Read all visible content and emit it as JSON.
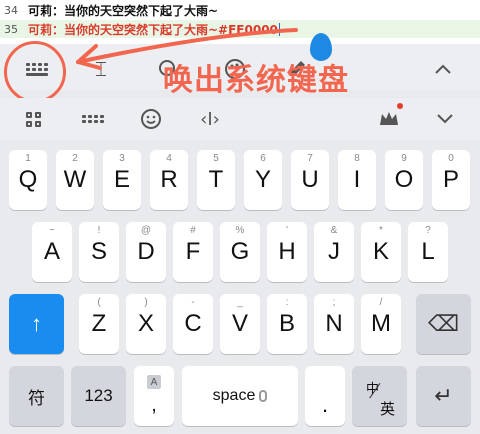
{
  "editor": {
    "lines": [
      {
        "number": "34",
        "text": "可莉：当你的天空突然下起了大雨~"
      },
      {
        "number": "35",
        "text": "可莉：当你的天空突然下起了大雨~#FF0000"
      }
    ]
  },
  "annotation": "唤出系统键盘",
  "colors": {
    "annotation": "#f2664f",
    "shift_key": "#1a8cf0",
    "line2_text": "#d93a2b"
  },
  "toolbar1": {
    "icons": [
      "keyboard-switch-icon",
      "text-cursor-icon",
      "search-icon",
      "palette-icon",
      "edit-icon",
      "chevron-up-icon"
    ],
    "chevron": "^"
  },
  "toolbar2": {
    "icons": [
      "grid-icon",
      "keyboard-icon",
      "emoji-icon",
      "cursor-move-icon",
      "crown-icon",
      "chevron-down-icon"
    ]
  },
  "keyboard": {
    "row1": [
      {
        "main": "Q",
        "sub": "1"
      },
      {
        "main": "W",
        "sub": "2"
      },
      {
        "main": "E",
        "sub": "3"
      },
      {
        "main": "R",
        "sub": "4"
      },
      {
        "main": "T",
        "sub": "5"
      },
      {
        "main": "Y",
        "sub": "6"
      },
      {
        "main": "U",
        "sub": "7"
      },
      {
        "main": "I",
        "sub": "8"
      },
      {
        "main": "O",
        "sub": "9"
      },
      {
        "main": "P",
        "sub": "0"
      }
    ],
    "row2": [
      {
        "main": "A",
        "sub": "~"
      },
      {
        "main": "S",
        "sub": "!"
      },
      {
        "main": "D",
        "sub": "@"
      },
      {
        "main": "F",
        "sub": "#"
      },
      {
        "main": "G",
        "sub": "%"
      },
      {
        "main": "H",
        "sub": "'"
      },
      {
        "main": "J",
        "sub": "&"
      },
      {
        "main": "K",
        "sub": "*"
      },
      {
        "main": "L",
        "sub": "?"
      }
    ],
    "row3": [
      {
        "main": "Z",
        "sub": "("
      },
      {
        "main": "X",
        "sub": ")"
      },
      {
        "main": "C",
        "sub": "-"
      },
      {
        "main": "V",
        "sub": "_"
      },
      {
        "main": "B",
        "sub": ":"
      },
      {
        "main": "N",
        "sub": ";"
      },
      {
        "main": "M",
        "sub": "/"
      }
    ],
    "shift": "↑",
    "backspace": "⌫",
    "symbols": "符",
    "numbers": "123",
    "comma": ",",
    "comma_badge": "A",
    "space": "space",
    "period": ".",
    "lang_top": "中",
    "lang_bottom": "英",
    "enter": "↵"
  }
}
